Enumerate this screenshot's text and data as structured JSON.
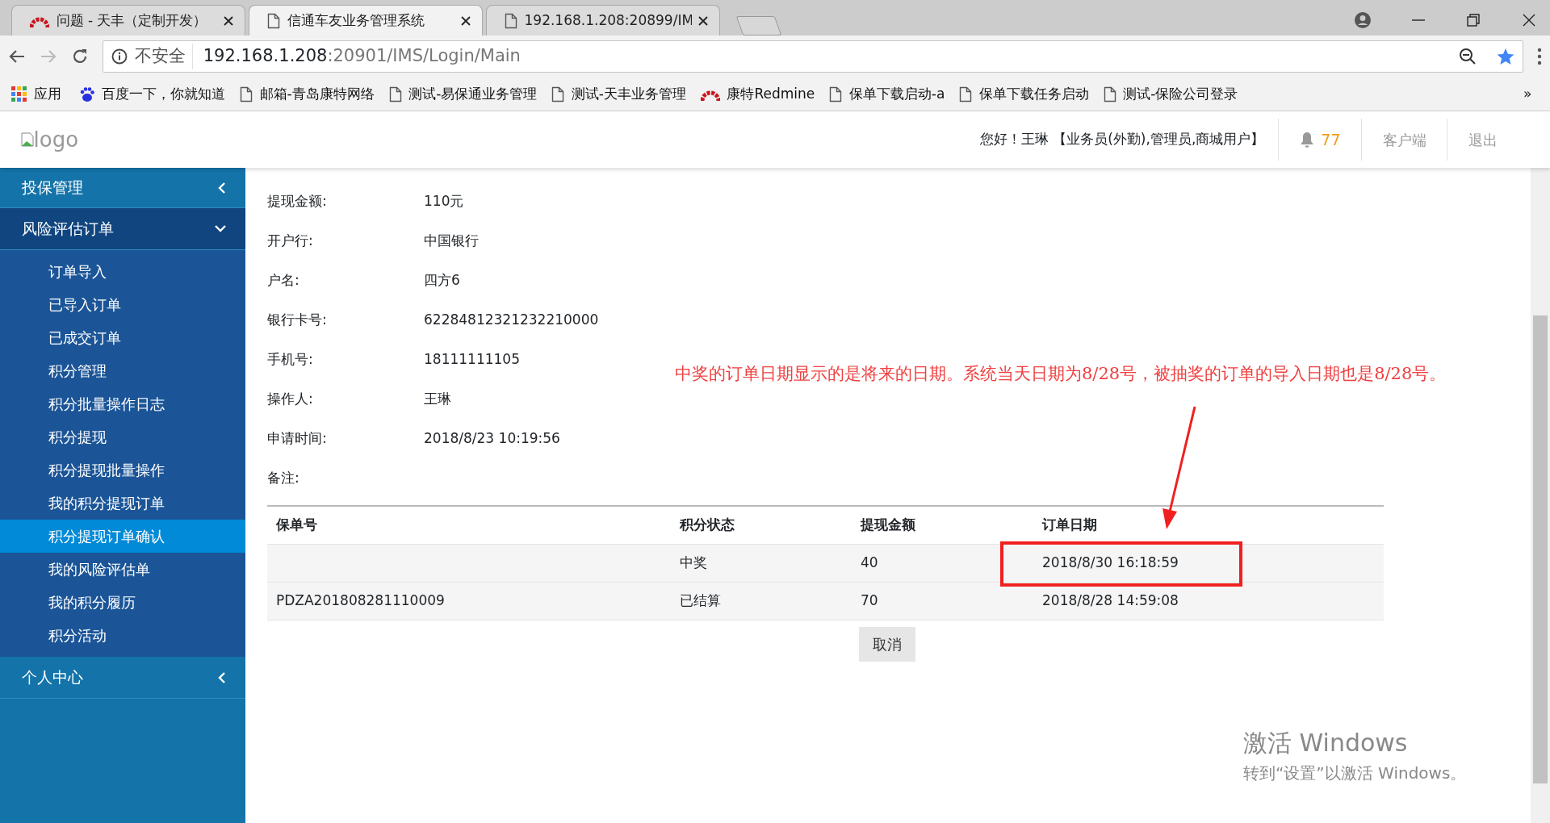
{
  "browser": {
    "tabs": [
      {
        "title": "问题 - 天丰（定制开发）",
        "kind": "redmine",
        "selected": false
      },
      {
        "title": "信通车友业务管理系统",
        "kind": "page",
        "selected": true
      },
      {
        "title": "192.168.1.208:20899/IM",
        "kind": "page",
        "selected": false
      }
    ],
    "address": {
      "security": "不安全",
      "host": "192.168.1.208",
      "path": ":20901/IMS/Login/Main"
    },
    "bookmarks": [
      {
        "label": "应用",
        "kind": "apps"
      },
      {
        "label": "百度一下，你就知道",
        "kind": "baidu"
      },
      {
        "label": "邮箱-青岛康特网络",
        "kind": "page"
      },
      {
        "label": "测试-易保通业务管理",
        "kind": "page"
      },
      {
        "label": "测试-天丰业务管理",
        "kind": "page"
      },
      {
        "label": "康特Redmine",
        "kind": "redmine"
      },
      {
        "label": "保单下载启动-a",
        "kind": "page"
      },
      {
        "label": "保单下载任务启动",
        "kind": "page"
      },
      {
        "label": "测试-保险公司登录",
        "kind": "page"
      }
    ],
    "more": "»"
  },
  "header": {
    "logo_alt": "logo",
    "greeting": "您好！王琳 【业务员(外勤),管理员,商城用户】",
    "notifications": "77",
    "links": [
      "客户端",
      "退出"
    ]
  },
  "sidebar": {
    "groups": [
      {
        "label": "投保管理",
        "expanded": false
      },
      {
        "label": "风险评估订单",
        "expanded": true,
        "children": [
          {
            "label": "订单导入",
            "selected": false
          },
          {
            "label": "已导入订单",
            "selected": false
          },
          {
            "label": "已成交订单",
            "selected": false
          },
          {
            "label": "积分管理",
            "selected": false
          },
          {
            "label": "积分批量操作日志",
            "selected": false
          },
          {
            "label": "积分提现",
            "selected": false
          },
          {
            "label": "积分提现批量操作",
            "selected": false
          },
          {
            "label": "我的积分提现订单",
            "selected": false
          },
          {
            "label": "积分提现订单确认",
            "selected": true
          },
          {
            "label": "我的风险评估单",
            "selected": false
          },
          {
            "label": "我的积分履历",
            "selected": false
          },
          {
            "label": "积分活动",
            "selected": false
          }
        ]
      },
      {
        "label": "个人中心",
        "expanded": false
      }
    ]
  },
  "details": [
    {
      "label": "提现金额:",
      "value": "110元"
    },
    {
      "label": "开户行:",
      "value": "中国银行"
    },
    {
      "label": "户名:",
      "value": "四方6"
    },
    {
      "label": "银行卡号:",
      "value": "62284812321232210000"
    },
    {
      "label": "手机号:",
      "value": "18111111105"
    },
    {
      "label": "操作人:",
      "value": "王琳"
    },
    {
      "label": "申请时间:",
      "value": "2018/8/23 10:19:56"
    },
    {
      "label": "备注:"
    }
  ],
  "table": {
    "columns": [
      "保单号",
      "积分状态",
      "提现金额",
      "订单日期"
    ],
    "rows": [
      {
        "cells": [
          "",
          "中奖",
          "40",
          "2018/8/30 16:18:59"
        ],
        "boxed": true
      },
      {
        "cells": [
          "PDZA201808281110009",
          "已结算",
          "70",
          "2018/8/28 14:59:08"
        ],
        "boxed": false
      }
    ]
  },
  "cancel_button": "取消",
  "annotation": {
    "text": "中奖的订单日期显示的是将来的日期。系统当天日期为8/28号，被抽奖的订单的导入日期也是8/28号。"
  },
  "os_watermark": [
    "激活 Windows",
    "转到“设置”以激活 Windows。"
  ]
}
